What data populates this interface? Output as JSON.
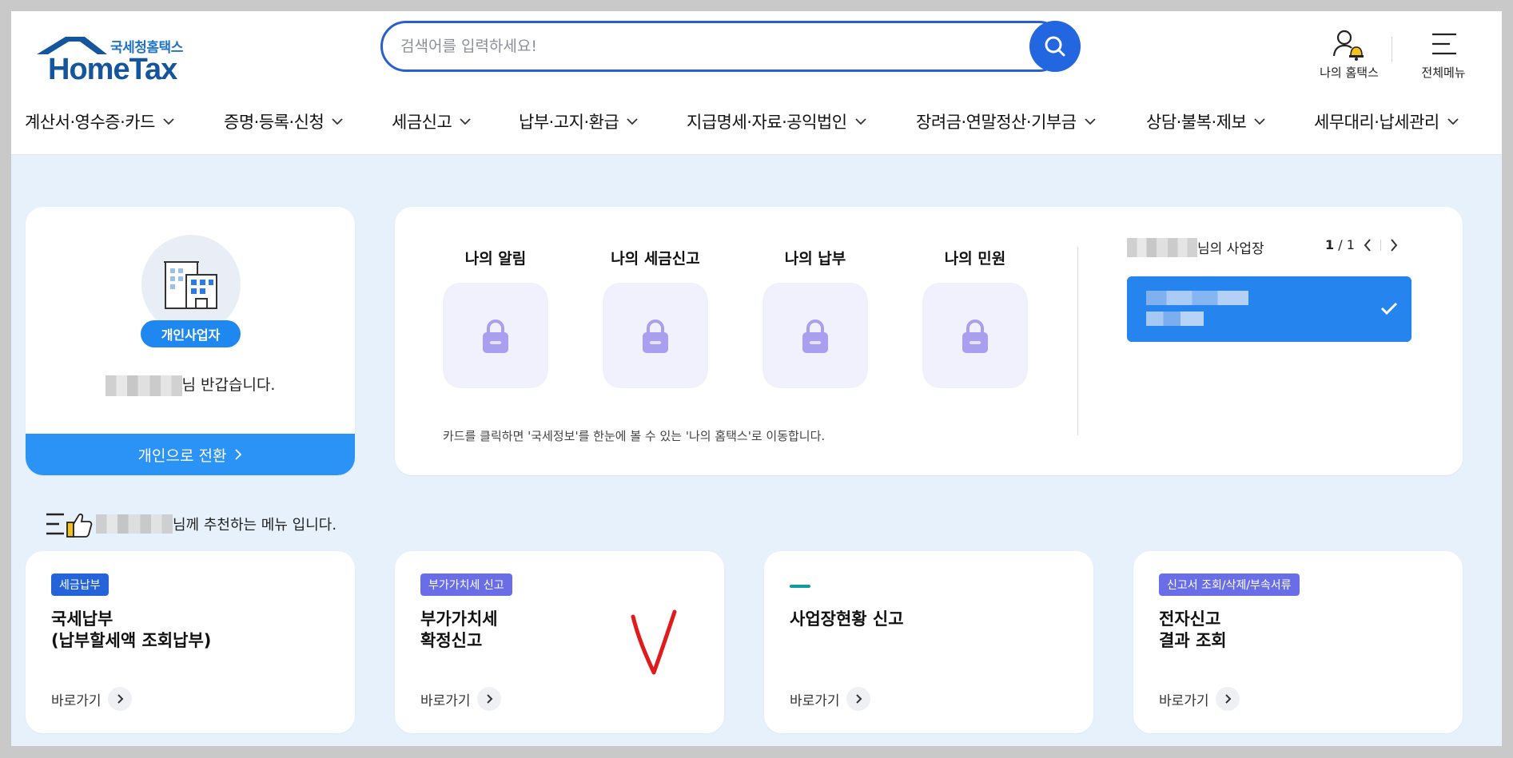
{
  "header": {
    "logo_sub": "국세청홈택스",
    "logo_main": "HomeTax",
    "search": {
      "placeholder": "검색어를 입력하세요!",
      "value": ""
    },
    "my_hometax_label": "나의 홈택스",
    "all_menu_label": "전체메뉴"
  },
  "nav": {
    "items": [
      {
        "label": "계산서·영수증·카드"
      },
      {
        "label": "증명·등록·신청"
      },
      {
        "label": "세금신고"
      },
      {
        "label": "납부·고지·환급"
      },
      {
        "label": "지급명세·자료·공익법인"
      },
      {
        "label": "장려금·연말정산·기부금"
      },
      {
        "label": "상담·불복·제보"
      },
      {
        "label": "세무대리·납세관리"
      }
    ]
  },
  "profile": {
    "role_badge": "개인사업자",
    "greeting_suffix": "님 반갑습니다.",
    "switch_label": "개인으로 전환"
  },
  "summary": {
    "tiles": [
      {
        "label": "나의 알림"
      },
      {
        "label": "나의 세금신고"
      },
      {
        "label": "나의 납부"
      },
      {
        "label": "나의 민원"
      }
    ],
    "note": "카드를 클릭하면 '국세정보'를 한눈에 볼 수 있는 '나의 홈택스'로 이동합니다.",
    "business": {
      "header_suffix": "님의 사업장",
      "page_current": "1",
      "page_total": "/ 1"
    }
  },
  "recommend": {
    "title_suffix": "님께 추천하는 메뉴 입니다.",
    "cards": [
      {
        "tag": "세금납부",
        "tag_color": "#2563d8",
        "name": "국세납부\n(납부할세액 조회납부)",
        "go": "바로가기"
      },
      {
        "tag": "부가가치세 신고",
        "tag_color": "#6a6ee6",
        "name": "부가가치세\n확정신고",
        "go": "바로가기"
      },
      {
        "tag": "",
        "tag_color": "#119ca0",
        "name": "사업장현황 신고",
        "go": "바로가기"
      },
      {
        "tag": "신고서 조회/삭제/부속서류",
        "tag_color": "#6a6ee6",
        "name": "전자신고\n결과 조회",
        "go": "바로가기"
      }
    ]
  },
  "colors": {
    "primary": "#2266e0",
    "switch_button": "#2b93f5",
    "business_box": "#2684ee",
    "lock_icon": "#a89ff0",
    "page_background": "#e7f1fb",
    "annotation_red": "#e11b1b"
  },
  "icons": {
    "search": "search-icon",
    "my_hometax": "user-bell-icon",
    "all_menu": "hamburger-icon",
    "lock": "lock-icon",
    "building": "building-icon",
    "recommend": "thumbs-up-list-icon"
  }
}
